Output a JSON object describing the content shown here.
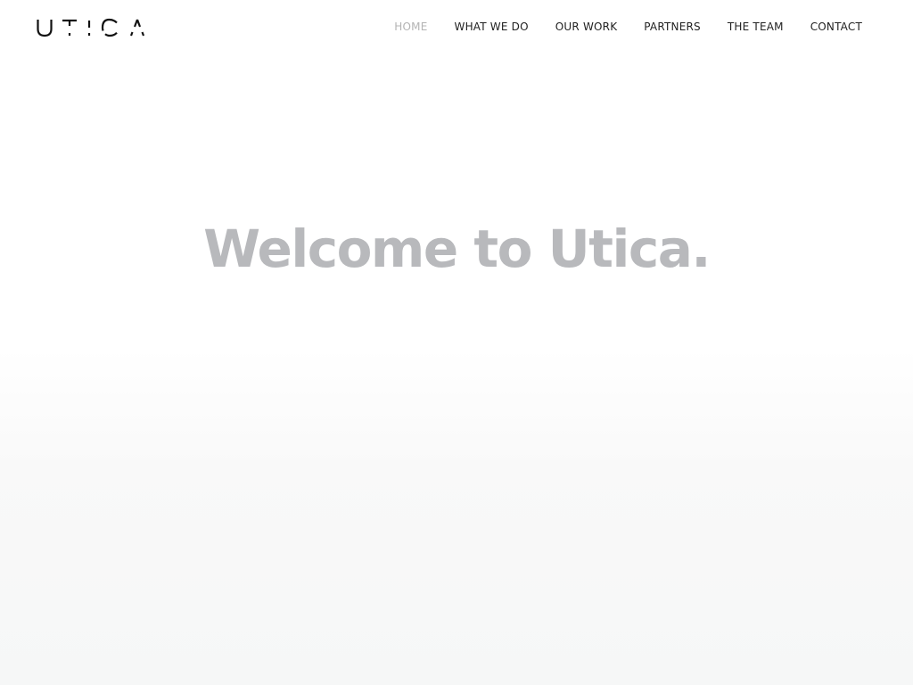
{
  "brand": {
    "logo_text": "UTICA"
  },
  "nav": {
    "items": [
      {
        "label": "HOME",
        "active": true
      },
      {
        "label": "WHAT WE DO",
        "active": false
      },
      {
        "label": "OUR WORK",
        "active": false
      },
      {
        "label": "PARTNERS",
        "active": false
      },
      {
        "label": "THE TEAM",
        "active": false
      },
      {
        "label": "CONTACT",
        "active": false
      }
    ]
  },
  "hero": {
    "title": "Welcome to Utica."
  },
  "colors": {
    "nav_text": "#222222",
    "nav_active": "#b4b4b4",
    "hero_title": "#b8b9bc",
    "logo": "#111111"
  }
}
